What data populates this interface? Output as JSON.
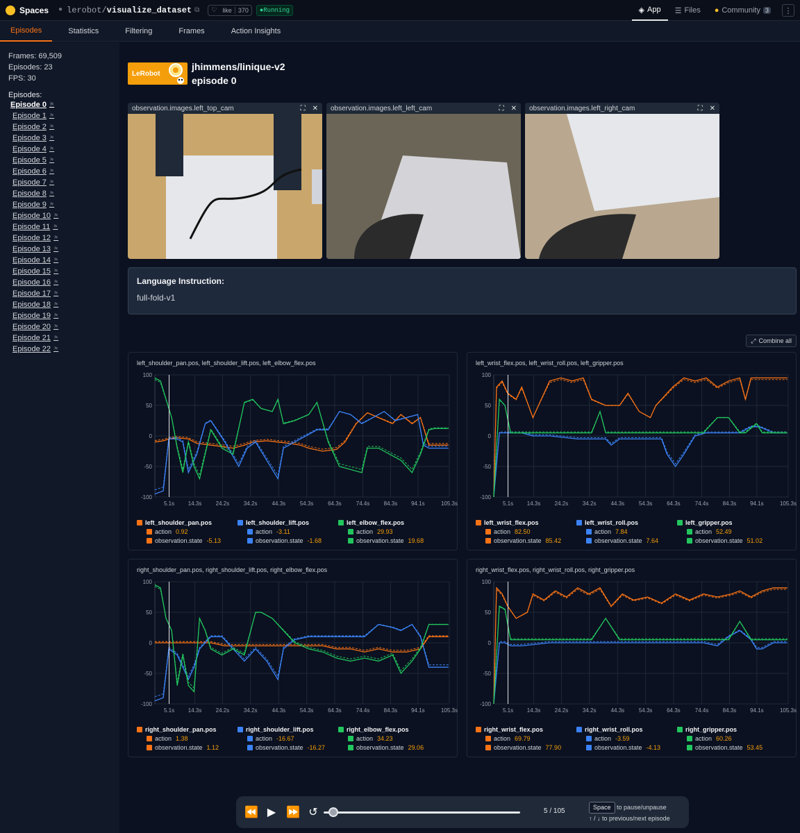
{
  "topbar": {
    "spaces": "Spaces",
    "owner": "lerobot",
    "name": "visualize_dataset",
    "like_label": "like",
    "like_count": "370",
    "status": "Running",
    "nav": [
      {
        "label": "App",
        "icon": "app-icon"
      },
      {
        "label": "Files",
        "icon": "files-icon"
      },
      {
        "label": "Community",
        "icon": "community-icon",
        "badge": "3"
      }
    ]
  },
  "tabs": [
    "Episodes",
    "Statistics",
    "Filtering",
    "Frames",
    "Action Insights"
  ],
  "sidebar": {
    "frames": "Frames: 69,509",
    "episodes": "Episodes: 23",
    "fps": "FPS: 30",
    "episodes_label": "Episodes:",
    "items": [
      "Episode 0",
      "Episode 1",
      "Episode 2",
      "Episode 3",
      "Episode 4",
      "Episode 5",
      "Episode 6",
      "Episode 7",
      "Episode 8",
      "Episode 9",
      "Episode 10",
      "Episode 11",
      "Episode 12",
      "Episode 13",
      "Episode 14",
      "Episode 15",
      "Episode 16",
      "Episode 17",
      "Episode 18",
      "Episode 19",
      "Episode 20",
      "Episode 21",
      "Episode 22"
    ]
  },
  "header": {
    "logo": "LeRobot",
    "dataset": "jhimmens/linique-v2",
    "episode": "episode 0"
  },
  "cameras": [
    {
      "title": "observation.images.left_top_cam"
    },
    {
      "title": "observation.images.left_left_cam"
    },
    {
      "title": "observation.images.left_right_cam"
    }
  ],
  "language": {
    "title": "Language Instruction:",
    "value": "full-fold-v1"
  },
  "combine_label": "Combine all",
  "colors": {
    "orange": "#f97316",
    "blue": "#3b82f6",
    "green": "#22c55e",
    "accent": "#f97316"
  },
  "chart_data": [
    {
      "type": "line",
      "title": "left_shoulder_pan.pos, left_shoulder_lift.pos, left_elbow_flex.pos",
      "x_ticks": [
        "5.1s",
        "14.3s",
        "24.2s",
        "34.2s",
        "44.3s",
        "54.3s",
        "64.3s",
        "74.4s",
        "84.3s",
        "94.1s",
        "105.3s"
      ],
      "y_ticks": [
        100,
        50,
        0,
        -50,
        -100
      ],
      "ylim": [
        -100,
        100
      ],
      "xlim": [
        0,
        105.3
      ],
      "cursor_x": 5.1,
      "series": [
        {
          "name": "left_shoulder_pan.pos",
          "color": "orange",
          "action": "0.92",
          "state": "-5.13",
          "x": [
            0,
            3,
            5,
            8,
            12,
            15,
            20,
            25,
            28,
            32,
            35,
            40,
            44,
            48,
            52,
            55,
            60,
            65,
            68,
            72,
            76,
            80,
            85,
            88,
            92,
            95,
            98,
            100,
            105
          ],
          "y": [
            -10,
            -8,
            -5,
            -3,
            -5,
            -12,
            -15,
            -18,
            -20,
            -15,
            -10,
            -8,
            -10,
            -12,
            -15,
            -20,
            -25,
            -22,
            -10,
            20,
            38,
            30,
            20,
            35,
            20,
            30,
            -15,
            -15,
            -15
          ]
        },
        {
          "name": "left_shoulder_lift.pos",
          "color": "blue",
          "action": "-3.11",
          "state": "-1.68",
          "x": [
            0,
            3,
            5,
            8,
            10,
            12,
            15,
            18,
            20,
            25,
            30,
            33,
            36,
            40,
            44,
            46,
            50,
            54,
            58,
            62,
            66,
            70,
            74,
            78,
            82,
            86,
            90,
            94,
            96,
            98,
            100,
            105
          ],
          "y": [
            -95,
            -90,
            -5,
            -5,
            -10,
            -60,
            -30,
            20,
            25,
            -10,
            -50,
            -20,
            -10,
            -40,
            -70,
            -20,
            -10,
            0,
            10,
            10,
            40,
            35,
            20,
            30,
            40,
            25,
            30,
            35,
            -15,
            -20,
            -20,
            -20
          ]
        },
        {
          "name": "left_elbow_flex.pos",
          "color": "green",
          "action": "29.93",
          "state": "19.68",
          "x": [
            0,
            2,
            4,
            6,
            8,
            10,
            12,
            14,
            16,
            20,
            24,
            28,
            32,
            35,
            38,
            42,
            44,
            46,
            50,
            55,
            58,
            62,
            66,
            70,
            74,
            76,
            80,
            84,
            88,
            92,
            95,
            98,
            100,
            105
          ],
          "y": [
            95,
            90,
            60,
            30,
            -20,
            -60,
            -10,
            -50,
            -70,
            10,
            -20,
            -30,
            55,
            60,
            45,
            40,
            60,
            20,
            25,
            35,
            55,
            -10,
            -50,
            -55,
            -60,
            -20,
            -20,
            -30,
            -40,
            -60,
            -30,
            10,
            12,
            12
          ]
        }
      ]
    },
    {
      "type": "line",
      "title": "left_wrist_flex.pos, left_wrist_roll.pos, left_gripper.pos",
      "x_ticks": [
        "5.1s",
        "14.3s",
        "24.2s",
        "34.2s",
        "44.3s",
        "54.3s",
        "64.3s",
        "74.4s",
        "84.3s",
        "94.1s",
        "105.3s"
      ],
      "y_ticks": [
        100,
        50,
        0,
        -50,
        -100
      ],
      "ylim": [
        -100,
        100
      ],
      "xlim": [
        0,
        105.3
      ],
      "cursor_x": 5.1,
      "series": [
        {
          "name": "left_wrist_flex.pos",
          "color": "orange",
          "action": "82.50",
          "state": "85.42",
          "x": [
            0,
            1,
            3,
            5,
            8,
            10,
            14,
            16,
            18,
            20,
            24,
            28,
            32,
            35,
            40,
            45,
            48,
            52,
            56,
            58,
            60,
            64,
            68,
            72,
            76,
            80,
            84,
            88,
            90,
            92,
            95,
            100,
            105
          ],
          "y": [
            -100,
            80,
            90,
            70,
            60,
            80,
            30,
            50,
            70,
            90,
            95,
            90,
            95,
            60,
            50,
            50,
            70,
            40,
            30,
            50,
            60,
            80,
            95,
            90,
            95,
            80,
            90,
            95,
            60,
            95,
            95,
            95,
            95
          ]
        },
        {
          "name": "left_wrist_roll.pos",
          "color": "blue",
          "action": "7.84",
          "state": "7.64",
          "x": [
            0,
            2,
            4,
            6,
            10,
            14,
            20,
            30,
            35,
            40,
            42,
            45,
            50,
            60,
            62,
            65,
            68,
            72,
            76,
            80,
            84,
            88,
            92,
            95,
            100,
            105
          ],
          "y": [
            -100,
            5,
            5,
            5,
            5,
            0,
            0,
            -5,
            -5,
            -5,
            -15,
            -5,
            -5,
            -5,
            -30,
            -50,
            -30,
            0,
            5,
            5,
            5,
            5,
            15,
            15,
            5,
            5
          ]
        },
        {
          "name": "left_gripper.pos",
          "color": "green",
          "action": "52.49",
          "state": "51.02",
          "x": [
            0,
            2,
            4,
            6,
            10,
            14,
            20,
            30,
            35,
            38,
            40,
            45,
            50,
            60,
            65,
            70,
            75,
            80,
            84,
            88,
            90,
            94,
            96,
            100,
            105
          ],
          "y": [
            -100,
            60,
            50,
            5,
            5,
            5,
            5,
            5,
            5,
            40,
            5,
            5,
            5,
            5,
            5,
            5,
            5,
            30,
            30,
            5,
            5,
            20,
            5,
            5,
            5
          ]
        }
      ]
    },
    {
      "type": "line",
      "title": "right_shoulder_pan.pos, right_shoulder_lift.pos, right_elbow_flex.pos",
      "x_ticks": [
        "5.1s",
        "14.3s",
        "24.2s",
        "34.2s",
        "44.3s",
        "54.3s",
        "64.3s",
        "74.4s",
        "84.3s",
        "94.1s",
        "105.3s"
      ],
      "y_ticks": [
        100,
        50,
        0,
        -50,
        -100
      ],
      "ylim": [
        -100,
        100
      ],
      "xlim": [
        0,
        105.3
      ],
      "cursor_x": 5.1,
      "series": [
        {
          "name": "right_shoulder_pan.pos",
          "color": "orange",
          "action": "1.38",
          "state": "1.12",
          "x": [
            0,
            5,
            10,
            15,
            20,
            25,
            30,
            35,
            40,
            45,
            50,
            55,
            60,
            65,
            70,
            75,
            80,
            85,
            90,
            95,
            98,
            100,
            105
          ],
          "y": [
            0,
            0,
            0,
            0,
            0,
            -5,
            -5,
            -5,
            -5,
            -5,
            -5,
            -5,
            -5,
            -10,
            -10,
            -15,
            -10,
            -15,
            -15,
            -10,
            10,
            10,
            10
          ]
        },
        {
          "name": "right_shoulder_lift.pos",
          "color": "blue",
          "action": "-16.67",
          "state": "-16.27",
          "x": [
            0,
            3,
            5,
            8,
            12,
            14,
            16,
            20,
            24,
            28,
            32,
            36,
            40,
            44,
            46,
            50,
            55,
            60,
            65,
            70,
            75,
            80,
            85,
            88,
            92,
            95,
            98,
            100,
            105
          ],
          "y": [
            -95,
            -90,
            -10,
            -20,
            -60,
            -40,
            -10,
            10,
            10,
            -10,
            -30,
            -10,
            -30,
            -60,
            -10,
            5,
            10,
            10,
            10,
            10,
            10,
            30,
            25,
            20,
            30,
            10,
            -40,
            -40,
            -40
          ]
        },
        {
          "name": "right_elbow_flex.pos",
          "color": "green",
          "action": "34.23",
          "state": "29.06",
          "x": [
            0,
            2,
            4,
            6,
            8,
            10,
            12,
            14,
            16,
            18,
            20,
            24,
            28,
            32,
            36,
            38,
            42,
            46,
            50,
            55,
            60,
            65,
            70,
            75,
            80,
            85,
            88,
            92,
            95,
            98,
            100,
            105
          ],
          "y": [
            95,
            90,
            40,
            20,
            -70,
            -20,
            -70,
            -80,
            40,
            20,
            -10,
            -20,
            -10,
            -20,
            50,
            50,
            40,
            20,
            0,
            -10,
            -15,
            -25,
            -30,
            -25,
            -30,
            -20,
            -50,
            -30,
            -10,
            30,
            30,
            30
          ]
        }
      ]
    },
    {
      "type": "line",
      "title": "right_wrist_flex.pos, right_wrist_roll.pos, right_gripper.pos",
      "x_ticks": [
        "5.1s",
        "14.3s",
        "24.2s",
        "34.2s",
        "44.3s",
        "54.3s",
        "64.3s",
        "74.4s",
        "84.3s",
        "94.1s",
        "105.3s"
      ],
      "y_ticks": [
        100,
        50,
        0,
        -50,
        -100
      ],
      "ylim": [
        -100,
        100
      ],
      "xlim": [
        0,
        105.3
      ],
      "cursor_x": 5.1,
      "series": [
        {
          "name": "right_wrist_flex.pos",
          "color": "orange",
          "action": "69.79",
          "state": "77.90",
          "x": [
            0,
            1,
            3,
            5,
            8,
            12,
            14,
            18,
            22,
            26,
            30,
            34,
            38,
            42,
            46,
            50,
            55,
            60,
            65,
            70,
            75,
            80,
            85,
            88,
            92,
            96,
            100,
            105
          ],
          "y": [
            -100,
            90,
            80,
            60,
            40,
            50,
            80,
            70,
            85,
            75,
            90,
            80,
            90,
            60,
            80,
            70,
            75,
            65,
            80,
            70,
            80,
            75,
            80,
            85,
            75,
            85,
            90,
            90
          ]
        },
        {
          "name": "right_wrist_roll.pos",
          "color": "blue",
          "action": "-3.59",
          "state": "-4.13",
          "x": [
            0,
            2,
            4,
            6,
            10,
            20,
            30,
            35,
            40,
            45,
            50,
            60,
            65,
            70,
            75,
            80,
            84,
            88,
            92,
            94,
            96,
            100,
            105
          ],
          "y": [
            -100,
            0,
            0,
            -5,
            -5,
            0,
            0,
            0,
            0,
            0,
            0,
            0,
            0,
            0,
            0,
            -5,
            10,
            20,
            5,
            -10,
            -10,
            0,
            0
          ]
        },
        {
          "name": "right_gripper.pos",
          "color": "green",
          "action": "60.26",
          "state": "53.45",
          "x": [
            0,
            2,
            4,
            6,
            10,
            14,
            20,
            30,
            35,
            40,
            45,
            50,
            60,
            65,
            70,
            75,
            80,
            84,
            88,
            92,
            96,
            100,
            105
          ],
          "y": [
            -100,
            60,
            55,
            5,
            5,
            5,
            5,
            5,
            5,
            40,
            5,
            5,
            5,
            5,
            5,
            5,
            5,
            5,
            35,
            5,
            5,
            5,
            5
          ]
        }
      ]
    }
  ],
  "legend_sublabels": {
    "action": "action",
    "state": "observation.state"
  },
  "player": {
    "count": "5 / 105",
    "progress": 0.048,
    "key": "Space",
    "hint1": "to pause/unpause",
    "hint2": "to previous/next episode",
    "arrows": "↑ / ↓"
  }
}
